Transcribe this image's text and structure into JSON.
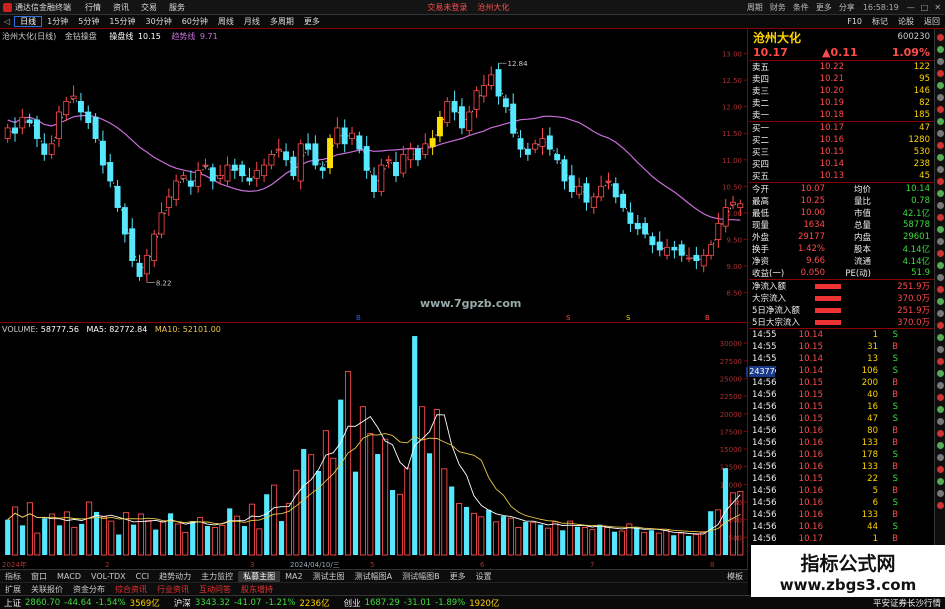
{
  "titlebar": {
    "app": "通达信金融终端",
    "tabs": [
      "行情",
      "资讯",
      "交易",
      "服务"
    ],
    "center_note": "交易未登录",
    "stock_name": "沧州大化",
    "time": "16:58:19",
    "menus": [
      "周期",
      "财务",
      "条件"
    ],
    "right": [
      "更多",
      "分享"
    ]
  },
  "menubar": {
    "periods": [
      "日线",
      "1分钟",
      "5分钟",
      "15分钟",
      "30分钟",
      "60分钟"
    ],
    "selected": "日线",
    "items": [
      "周线",
      "月线",
      "多周期",
      "更多"
    ],
    "right": [
      "F10",
      "标记",
      "论股",
      "返回"
    ]
  },
  "kline": {
    "header": "沧州大化(日线)",
    "indicator_name": "金钻操盘",
    "label1": "操盘线",
    "value1": "10.15",
    "label2": "趋势线",
    "value2": "9.71",
    "max_label": "12.84",
    "min_label": "8.22",
    "site": "www.7gpzb.com",
    "month_marks": [
      "B",
      "S",
      "S",
      "B"
    ],
    "y_ticks": [
      "13.00",
      "12.50",
      "12.00",
      "11.50",
      "11.00",
      "10.50",
      "10.00",
      "9.50",
      "9.00",
      "8.50"
    ],
    "bottom_label": "□ 日 1分钟 5分钟 15分钟 30分钟 60分钟 日线 周线 月线 多周期 更多"
  },
  "volume": {
    "header": "VOLUME:",
    "vol": "58777.56",
    "ma5_label": "MA5:",
    "ma5": "82772.84",
    "ma10_label": "MA10:",
    "ma10": "52101.00",
    "y_ticks": [
      "30000",
      "27500",
      "25000",
      "22500",
      "20000",
      "17500",
      "15000",
      "12500",
      "10000",
      "7500",
      "5000",
      "2500"
    ],
    "current_tag": "24377",
    "dates": [
      "2024年",
      "2",
      "3",
      "2024/04/10/三",
      "5",
      "6",
      "7",
      "8"
    ]
  },
  "quote": {
    "name": "沧州大化",
    "code": "600230",
    "price": "10.17",
    "change": "▲0.11",
    "pct": "1.09%",
    "asks": [
      [
        "卖五",
        "10.22",
        "122"
      ],
      [
        "卖四",
        "10.21",
        "95"
      ],
      [
        "卖三",
        "10.20",
        "146"
      ],
      [
        "卖二",
        "10.19",
        "82"
      ],
      [
        "卖一",
        "10.18",
        "185"
      ]
    ],
    "bids": [
      [
        "买一",
        "10.17",
        "47"
      ],
      [
        "买二",
        "10.16",
        "1280"
      ],
      [
        "买三",
        "10.15",
        "530"
      ],
      [
        "买四",
        "10.14",
        "238"
      ],
      [
        "买五",
        "10.13",
        "45"
      ]
    ],
    "stats": [
      [
        "今开",
        "10.07",
        "均价",
        "10.14"
      ],
      [
        "最高",
        "10.25",
        "量比",
        "0.78"
      ],
      [
        "最低",
        "10.00",
        "市值",
        "42.1亿"
      ],
      [
        "现量",
        "1634",
        "总量",
        "58778"
      ],
      [
        "外盘",
        "29177",
        "内盘",
        "29601"
      ],
      [
        "换手",
        "1.42%",
        "股本",
        "4.14亿"
      ],
      [
        "净资",
        "9.66",
        "流通",
        "4.14亿"
      ],
      [
        "收益(一)",
        "0.050",
        "PE(动)",
        "51.9"
      ]
    ],
    "flows": [
      [
        "净流入额",
        "251.9万"
      ],
      [
        "大宗流入",
        "370.0万"
      ],
      [
        "5日净流入额",
        "251.9万"
      ],
      [
        "5日大宗流入",
        "370.0万"
      ]
    ],
    "ticks": [
      [
        "14:55",
        "10.14",
        "1",
        "S"
      ],
      [
        "14:55",
        "10.15",
        "31",
        "B"
      ],
      [
        "14:55",
        "10.14",
        "13",
        "S"
      ],
      [
        "14:56",
        "10.14",
        "106",
        "S"
      ],
      [
        "14:56",
        "10.15",
        "200",
        "B"
      ],
      [
        "14:56",
        "10.15",
        "40",
        "B"
      ],
      [
        "14:56",
        "10.15",
        "16",
        "S"
      ],
      [
        "14:56",
        "10.15",
        "47",
        "S"
      ],
      [
        "14:56",
        "10.16",
        "80",
        "B"
      ],
      [
        "14:56",
        "10.16",
        "133",
        "B"
      ],
      [
        "14:56",
        "10.16",
        "178",
        "S"
      ],
      [
        "14:56",
        "10.16",
        "133",
        "B"
      ],
      [
        "14:56",
        "10.15",
        "22",
        "S"
      ],
      [
        "14:56",
        "10.16",
        "5",
        "B"
      ],
      [
        "14:56",
        "10.16",
        "6",
        "S"
      ],
      [
        "14:56",
        "10.16",
        "133",
        "B"
      ],
      [
        "14:56",
        "10.16",
        "44",
        "S"
      ],
      [
        "14:56",
        "10.17",
        "1",
        "B"
      ]
    ]
  },
  "tabs": {
    "items": [
      "指标",
      "窗口",
      "MACD",
      "VOL-TDX",
      "CCI",
      "趋势动力",
      "主力监控",
      "私募主图",
      "MA2",
      "测试主图",
      "测试幅图A",
      "测试幅图B",
      "更多",
      "设置"
    ],
    "active": "私募主图",
    "right": "模板"
  },
  "bottom_tabs": {
    "items": [
      "扩展",
      "关联报价",
      "资金分布",
      "综合资讯",
      "行业资讯",
      "互动问答",
      "股东增持"
    ]
  },
  "index_bar": [
    [
      "上证",
      "2860.70",
      "-44.64",
      "-1.54%",
      "3569亿"
    ],
    [
      "沪深",
      "3343.32",
      "-41.07",
      "-1.21%",
      "2236亿"
    ],
    [
      "创业",
      "1687.29",
      "-31.01",
      "-1.89%",
      "1920亿"
    ]
  ],
  "index_bar_right": "平安证券长沙行情",
  "watermark": {
    "line1": "指标公式网",
    "line2": "www.zbgs3.com"
  },
  "colors": {
    "up": "#ff4b4b",
    "down": "#56e8ff",
    "ma": "#c86dd7",
    "ma5": "#ffffff",
    "ma10": "#e8c84a",
    "highlight": "#ffe000",
    "border": "#8b0000"
  },
  "chart_data": [
    {
      "type": "candlestick",
      "title": "沧州大化(日线) 金钻操盘",
      "ylim": [
        8.0,
        13.2
      ],
      "y_ticks": [
        13.0,
        12.5,
        12.0,
        11.5,
        11.0,
        10.5,
        10.0,
        9.5,
        9.0,
        8.5
      ],
      "series": [
        {
          "name": "操盘线",
          "last": 10.15
        },
        {
          "name": "趋势线",
          "last": 9.71
        }
      ],
      "high_marker": 12.84,
      "low_marker": 8.22,
      "close": [
        11.6,
        11.5,
        11.8,
        11.7,
        11.4,
        11.1,
        11.3,
        11.9,
        12.1,
        12.2,
        11.9,
        11.7,
        11.4,
        10.9,
        10.6,
        10.1,
        9.6,
        9.1,
        8.8,
        9.2,
        9.6,
        10.0,
        10.3,
        10.6,
        10.7,
        10.5,
        10.8,
        10.9,
        10.6,
        10.7,
        10.9,
        10.8,
        10.7,
        10.6,
        10.8,
        10.9,
        11.1,
        11.2,
        11.0,
        10.7,
        11.3,
        11.2,
        10.9,
        10.8,
        11.4,
        11.6,
        11.3,
        11.5,
        11.2,
        10.8,
        10.4,
        10.9,
        11.0,
        10.7,
        11.1,
        11.2,
        11.0,
        11.3,
        11.4,
        11.8,
        12.1,
        11.9,
        11.6,
        11.9,
        12.3,
        12.4,
        12.6,
        12.2,
        12.0,
        11.5,
        11.2,
        11.1,
        11.3,
        11.4,
        11.2,
        11.0,
        10.6,
        10.4,
        10.5,
        10.2,
        10.3,
        10.5,
        10.6,
        10.3,
        10.1,
        9.8,
        9.7,
        9.6,
        9.4,
        9.3,
        9.35,
        9.3,
        9.2,
        9.15,
        9.1,
        9.2,
        9.4,
        9.8,
        10.1,
        10.2,
        10.17
      ]
    },
    {
      "type": "bar",
      "title": "VOLUME",
      "ylim": [
        0,
        32000
      ],
      "y_ticks": [
        30000,
        27500,
        25000,
        22500,
        20000,
        17500,
        15000,
        12500,
        10000,
        7500,
        5000,
        2500
      ],
      "series": [
        {
          "name": "VOLUME",
          "last": 58777.56
        },
        {
          "name": "MA5",
          "last": 82772.84
        },
        {
          "name": "MA10",
          "last": 52101.0
        }
      ],
      "values": [
        5000,
        6800,
        4200,
        7400,
        3100,
        5200,
        5800,
        4200,
        6100,
        3900,
        4400,
        7500,
        6100,
        5400,
        4800,
        2900,
        6000,
        4300,
        5800,
        4900,
        3600,
        4700,
        5900,
        4400,
        3200,
        4800,
        5300,
        4100,
        3900,
        4200,
        6600,
        5500,
        4100,
        7200,
        3700,
        8600,
        9900,
        4800,
        7300,
        12000,
        15000,
        14200,
        11900,
        17600,
        13700,
        22000,
        26000,
        11800,
        21000,
        17200,
        14300,
        16400,
        9200,
        8600,
        12300,
        31000,
        21000,
        14400,
        20600,
        12200,
        9700,
        7300,
        6800,
        5900,
        5400,
        6400,
        4700,
        5500,
        5200,
        3900,
        4700,
        4600,
        4300,
        3800,
        4700,
        3500,
        4800,
        4000,
        3900,
        3600,
        4300,
        3900,
        3300,
        3400,
        4400,
        3900,
        3200,
        3500,
        3100,
        3500,
        2800,
        3100,
        2700,
        2900,
        3300,
        6200,
        6400,
        12300,
        8800,
        9000
      ]
    }
  ]
}
